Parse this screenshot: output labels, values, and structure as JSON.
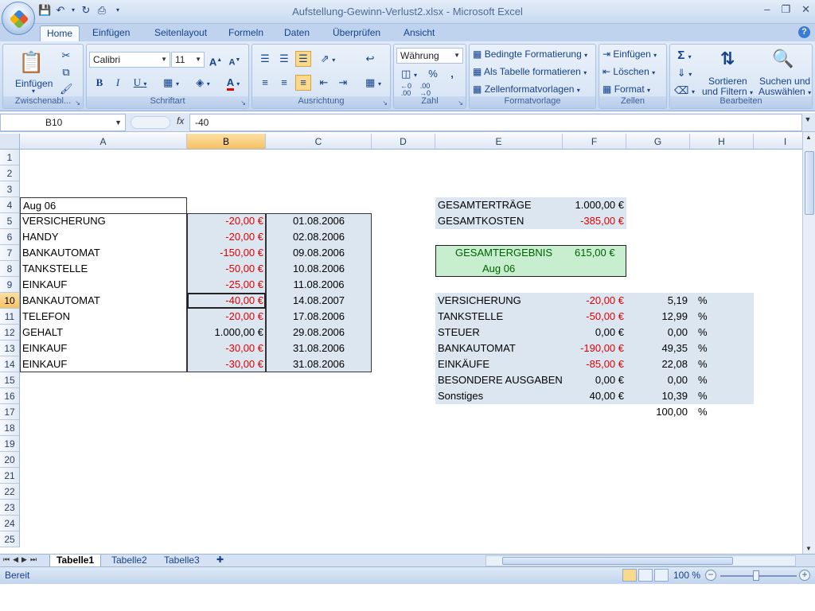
{
  "window": {
    "title": "Aufstellung-Gewinn-Verlust2.xlsx - Microsoft Excel"
  },
  "ribbon": {
    "tabs": [
      "Home",
      "Einfügen",
      "Seitenlayout",
      "Formeln",
      "Daten",
      "Überprüfen",
      "Ansicht"
    ],
    "active_tab": "Home",
    "clipboard": {
      "paste_label": "Einfügen",
      "group_label": "Zwischenabl..."
    },
    "font": {
      "name": "Calibri",
      "size": "11",
      "group_label": "Schriftart"
    },
    "alignment": {
      "group_label": "Ausrichtung"
    },
    "number": {
      "format": "Währung",
      "percent": "%",
      "thousands": ",",
      "group_label": "Zahl"
    },
    "styles": {
      "conditional": "Bedingte Formatierung",
      "as_table": "Als Tabelle formatieren",
      "cell_styles": "Zellenformatvorlagen",
      "group_label": "Formatvorlage"
    },
    "cells": {
      "insert": "Einfügen",
      "delete": "Löschen",
      "format": "Format",
      "group_label": "Zellen"
    },
    "editing": {
      "sort_1": "Sortieren",
      "sort_2": "und Filtern",
      "find_1": "Suchen und",
      "find_2": "Auswählen",
      "group_label": "Bearbeiten"
    }
  },
  "formula_bar": {
    "name_box": "B10",
    "fx": "fx",
    "value": "-40"
  },
  "columns": [
    "A",
    "B",
    "C",
    "D",
    "E",
    "F",
    "G",
    "H",
    "I"
  ],
  "selected_column": "B",
  "selected_row": "10",
  "rows": [
    "1",
    "2",
    "3",
    "4",
    "5",
    "6",
    "7",
    "8",
    "9",
    "10",
    "11",
    "12",
    "13",
    "14",
    "15",
    "16",
    "17",
    "18",
    "19",
    "20",
    "21",
    "22",
    "23",
    "24",
    "25"
  ],
  "ledger": {
    "heading": "Aug 06",
    "entries": [
      {
        "label": " VERSICHERUNG",
        "amount": "-20,00 €",
        "date": "01.08.2006",
        "negative": true
      },
      {
        "label": "HANDY",
        "amount": "-20,00 €",
        "date": "02.08.2006",
        "negative": true
      },
      {
        "label": "BANKAUTOMAT",
        "amount": "-150,00 €",
        "date": "09.08.2006",
        "negative": true
      },
      {
        "label": "TANKSTELLE",
        "amount": "-50,00 €",
        "date": "10.08.2006",
        "negative": true
      },
      {
        "label": "EINKAUF",
        "amount": "-25,00 €",
        "date": "11.08.2006",
        "negative": true
      },
      {
        "label": "BANKAUTOMAT",
        "amount": "-40,00 €",
        "date": "14.08.2007",
        "negative": true
      },
      {
        "label": "TELEFON",
        "amount": "-20,00 €",
        "date": "17.08.2006",
        "negative": true
      },
      {
        "label": "GEHALT",
        "amount": "1.000,00 €",
        "date": "29.08.2006",
        "negative": false
      },
      {
        "label": "EINKAUF",
        "amount": "-30,00 €",
        "date": "31.08.2006",
        "negative": true
      },
      {
        "label": "EINKAUF",
        "amount": "-30,00 €",
        "date": "31.08.2006",
        "negative": true
      }
    ]
  },
  "totals": {
    "income_label": "GESAMTERTRÄGE",
    "income_value": "1.000,00 €",
    "costs_label": "GESAMTKOSTEN",
    "costs_value": "-385,00 €",
    "result_label": "GESAMTERGEBNIS",
    "result_value": "615,00 €",
    "result_period": "Aug 06"
  },
  "breakdown": {
    "items": [
      {
        "label": "VERSICHERUNG",
        "amount": "-20,00 €",
        "percent": "5,19",
        "unit": "%",
        "negative": true
      },
      {
        "label": "TANKSTELLE",
        "amount": "-50,00 €",
        "percent": "12,99",
        "unit": "%",
        "negative": true
      },
      {
        "label": "STEUER",
        "amount": "0,00 €",
        "percent": "0,00",
        "unit": "%",
        "negative": false
      },
      {
        "label": "BANKAUTOMAT",
        "amount": "-190,00 €",
        "percent": "49,35",
        "unit": "%",
        "negative": true
      },
      {
        "label": "EINKÄUFE",
        "amount": "-85,00 €",
        "percent": "22,08",
        "unit": "%",
        "negative": true
      },
      {
        "label": "BESONDERE AUSGABEN",
        "amount": "0,00 €",
        "percent": "0,00",
        "unit": "%",
        "negative": false
      },
      {
        "label": "Sonstiges",
        "amount": "40,00 €",
        "percent": "10,39",
        "unit": "%",
        "negative": false
      }
    ],
    "total_percent": "100,00",
    "total_unit": "%"
  },
  "sheets": {
    "tabs": [
      "Tabelle1",
      "Tabelle2",
      "Tabelle3"
    ],
    "active": "Tabelle1"
  },
  "status": {
    "text": "Bereit",
    "zoom": "100 %"
  }
}
